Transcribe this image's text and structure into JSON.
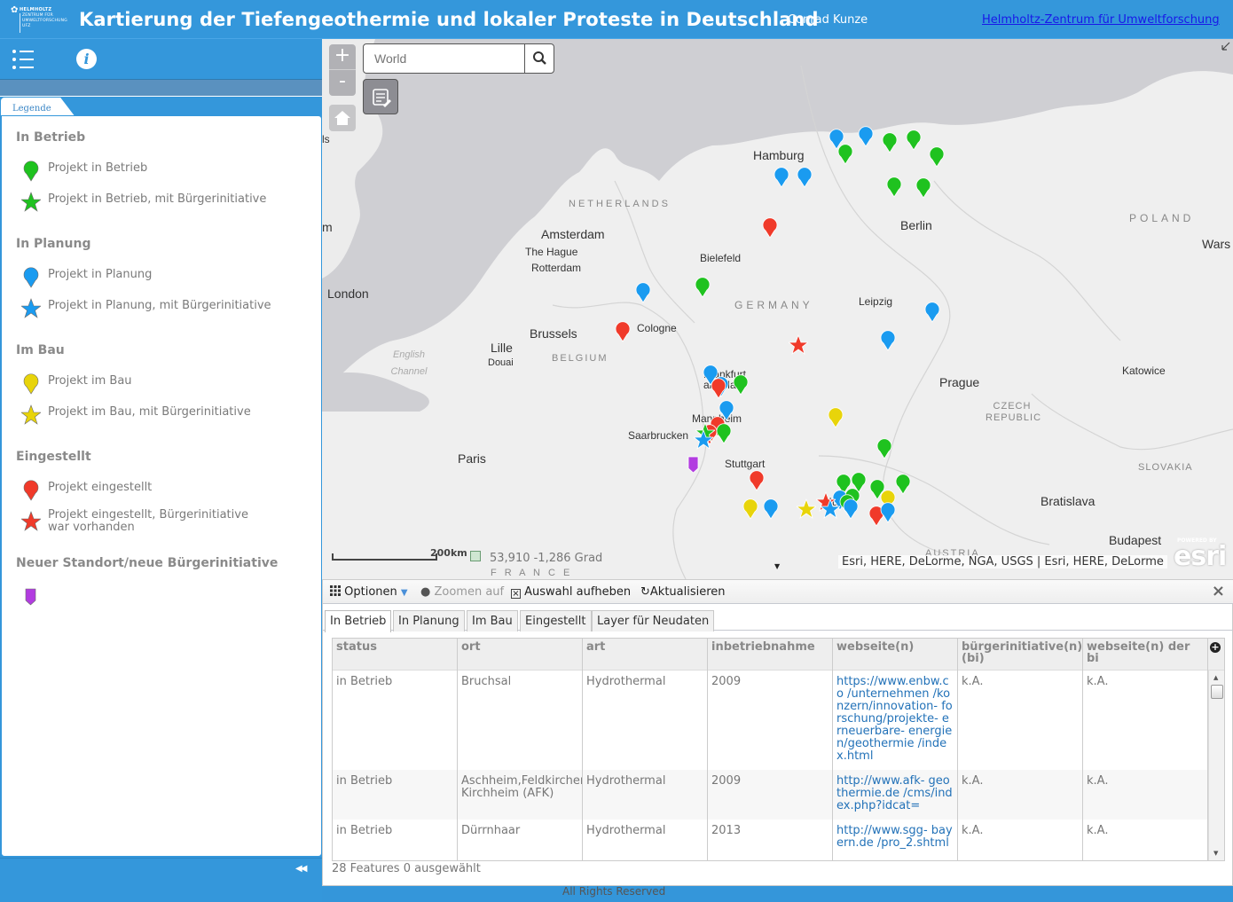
{
  "header": {
    "logo_lines": [
      "HELMHOLTZ",
      "ZENTRUM FÜR",
      "UMWELTFORSCHUNG",
      "UFZ"
    ],
    "title": "Kartierung der Tiefengeothermie und lokaler Proteste in Deutschland",
    "author": "Conrad Kunze",
    "org_link": "Helmholtz-Zentrum für Umweltforschung"
  },
  "sidebar": {
    "tab_label": "Legende",
    "groups": [
      {
        "heading": "In Betrieb",
        "items": [
          {
            "label": "Projekt in Betrieb",
            "symbol": "pin",
            "color": "#1fc21f"
          },
          {
            "label": "Projekt in Betrieb, mit Bürgerinitiative",
            "symbol": "star",
            "color": "#1fc21f"
          }
        ]
      },
      {
        "heading": "In Planung",
        "items": [
          {
            "label": "Projekt in Planung",
            "symbol": "pin",
            "color": "#1a9bf0"
          },
          {
            "label": "Projekt in Planung, mit Bürgerinitiative",
            "symbol": "star",
            "color": "#1a9bf0"
          }
        ]
      },
      {
        "heading": "Im Bau",
        "items": [
          {
            "label": "Projekt im Bau",
            "symbol": "pin",
            "color": "#e8d40a"
          },
          {
            "label": "Projekt im Bau, mit Bürgerinitiative",
            "symbol": "star",
            "color": "#e8d40a"
          }
        ]
      },
      {
        "heading": "Eingestellt",
        "items": [
          {
            "label": "Projekt eingestellt",
            "symbol": "pin",
            "color": "#f03a2a"
          },
          {
            "label": "Projekt eingestellt, Bürgerinitiative war vorhanden",
            "symbol": "star",
            "color": "#f03a2a"
          }
        ]
      },
      {
        "heading": "Neuer Standort/neue Bürgerinitiative",
        "items": [
          {
            "label": "",
            "symbol": "square-pin",
            "color": "#b23ce0"
          }
        ]
      }
    ]
  },
  "map": {
    "search_placeholder": "World",
    "zoom_in": "+",
    "zoom_out": "-",
    "scale_label": "200km",
    "coordinates": "53,910  -1,286 Grad",
    "attribution": "Esri, HERE, DeLorme, NGA, USGS | Esri, HERE, DeLorme",
    "esri_powered": "POWERED BY",
    "esri_brand": "esri",
    "labels": {
      "cities": [
        "Hamburg",
        "Berlin",
        "Amsterdam",
        "The Hague",
        "Rotterdam",
        "Bielefeld",
        "London",
        "Cologne",
        "Leipzig",
        "Brussels",
        "Lille",
        "Douai",
        "Frankfurt am Main",
        "Prague",
        "Katowice",
        "Mannheim",
        "Saarbrucken",
        "Paris",
        "Stuttgart",
        "Munich",
        "Bratislava",
        "Budapest",
        "Wars",
        "ls",
        "m"
      ],
      "countries": [
        "NETHERLANDS",
        "GERMANY",
        "POLAND",
        "BELGIUM",
        "CZECH REPUBLIC",
        "SLOVAKIA",
        "AUSTRIA",
        "F R A N C E"
      ],
      "seas": [
        "English Channel"
      ]
    }
  },
  "table": {
    "toolbar": {
      "options": "Optionen",
      "zoom_to": "Zoomen auf",
      "clear_selection": "Auswahl aufheben",
      "refresh": "Aktualisieren"
    },
    "tabs": [
      "In Betrieb",
      "In Planung",
      "Im Bau",
      "Eingestellt",
      "Layer für Neudaten"
    ],
    "active_tab": "In Betrieb",
    "columns": [
      "status",
      "ort",
      "art",
      "inbetriebnahme",
      "webseite(n)",
      "bürgerinitiative(n) (bi)",
      "webseite(n) der bi"
    ],
    "rows": [
      {
        "status": "in Betrieb",
        "ort": "Bruchsal",
        "art": "Hydrothermal",
        "inbetriebnahme": "2009",
        "webseite": "https://www.enbw.co /unternehmen /konzern/innovation- forschung/projekte- erneuerbare- energien/geothermie /index.html",
        "bi": "k.A.",
        "bi_web": "k.A."
      },
      {
        "status": "in Betrieb",
        "ort": "Aschheim,Feldkirchen, Kirchheim (AFK)",
        "art": "Hydrothermal",
        "inbetriebnahme": "2009",
        "webseite": "http://www.afk- geothermie.de /cms/index.php?idcat=",
        "bi": "k.A.",
        "bi_web": "k.A."
      },
      {
        "status": "in Betrieb",
        "ort": "Dürrnhaar",
        "art": "Hydrothermal",
        "inbetriebnahme": "2013",
        "webseite": "http://www.sgg- bayern.de /pro_2.shtml",
        "bi": "k.A.",
        "bi_web": "k.A."
      }
    ],
    "status_line": "28 Features 0 ausgewählt"
  },
  "footer": {
    "rights": "All Rights Reserved"
  }
}
